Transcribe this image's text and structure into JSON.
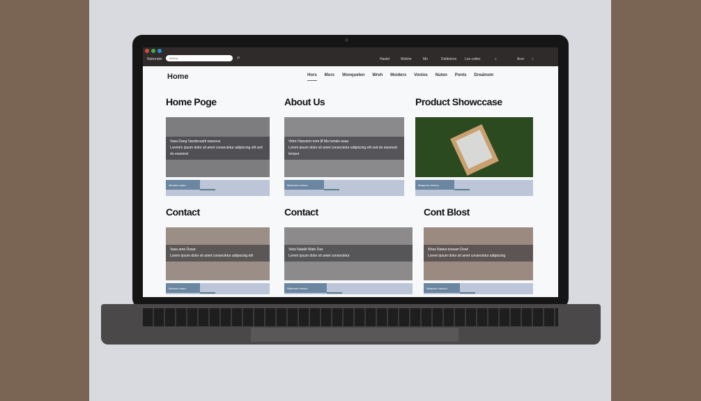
{
  "browser": {
    "bookmarks_label": "Nahender",
    "search_value": "Aertow",
    "menu": [
      "Hastel",
      "Wekhe",
      "Mo",
      "Deldelons",
      "Los cstfes",
      "Acer"
    ]
  },
  "site": {
    "brand": "Home",
    "nav": [
      "Hors",
      "Mors",
      "Wonquelen",
      "Wreh",
      "Moiders",
      "Vonlos",
      "Nuten",
      "Ponts",
      "Drealnom"
    ]
  },
  "cards": [
    {
      "title": "Home Poge",
      "overlay_title": "Vasa Dang Vasdiscastit easuous",
      "overlay_text": "Loremm ipsum dolor sit amet consectetur adipiscing elit sed do eiusmod",
      "button": "Mantum raaro",
      "image": "#7d7d80"
    },
    {
      "title": "About Us",
      "overlay_title": "Vetre Hasvarm nom Ø Ma tuntals asaa",
      "overlay_text": "Lorem ipsum dolor sit amet consectetur adipiscing elit sed do eiusmod tempor",
      "button": "Masrosm mesun",
      "image": "#8a8a8c"
    },
    {
      "title": "Product Showccase",
      "overlay_title": "",
      "overlay_text": "",
      "button": "Masprom mesun",
      "image": "#2c4a20"
    },
    {
      "title": "Contact",
      "overlay_title": "Vasa ame Dosar",
      "overlay_text": "Lorem ipsum dolor sit amet consectetur adipiscing elit",
      "button": "Mantum raaro",
      "image": "#9a8e86"
    },
    {
      "title": "Contact",
      "overlay_title": "Vetsi Natalit Wato Das",
      "overlay_text": "Lorem ipsum dolor sit amet consectetur",
      "button": "Masrosm mesun",
      "image": "#8c8a8a"
    },
    {
      "title": "Cont Blost",
      "overlay_title": "Wras Natwa toosam Dowt",
      "overlay_text": "Lorem ipsum dolor sit amet consectetur adipiscing",
      "button": "Masprom mesun",
      "image": "#9b8a80"
    }
  ]
}
